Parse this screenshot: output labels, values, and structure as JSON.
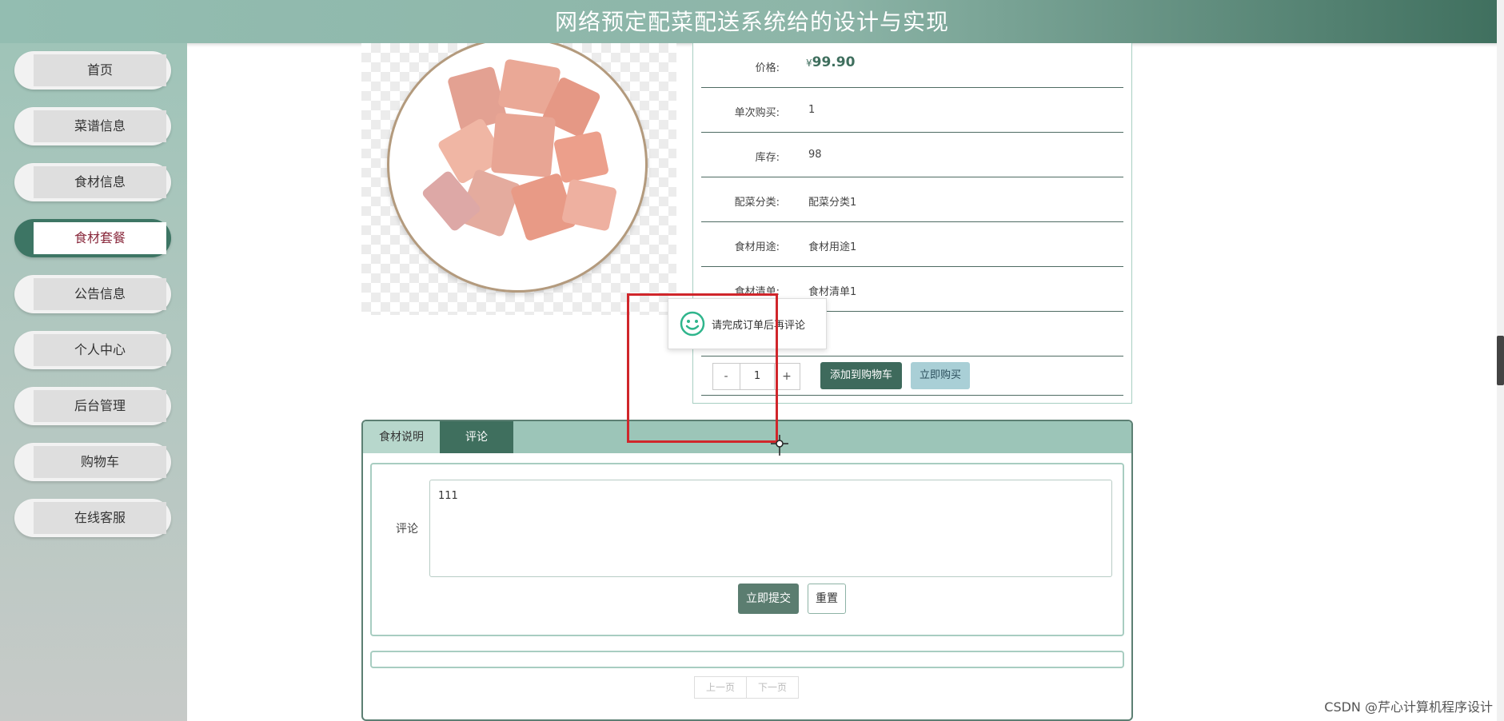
{
  "header": {
    "title": "网络预定配菜配送系统给的设计与实现"
  },
  "sidebar": {
    "items": [
      {
        "label": "首页"
      },
      {
        "label": "菜谱信息"
      },
      {
        "label": "食材信息"
      },
      {
        "label": "食材套餐"
      },
      {
        "label": "公告信息"
      },
      {
        "label": "个人中心"
      },
      {
        "label": "后台管理"
      },
      {
        "label": "购物车"
      },
      {
        "label": "在线客服"
      }
    ],
    "active": "食材套餐"
  },
  "product": {
    "price_label": "价格:",
    "price_symbol": "¥",
    "price_value": "99.90",
    "single_buy_label": "单次购买:",
    "single_buy_value": "1",
    "stock_label": "库存:",
    "stock_value": "98",
    "category_label": "配菜分类:",
    "category_value": "配菜分类1",
    "usage_label": "食材用途:",
    "usage_value": "食材用途1",
    "list_label": "食材清单:",
    "list_value": "食材清单1"
  },
  "quantity": {
    "minus": "-",
    "value": "1",
    "plus": "+"
  },
  "actions": {
    "add_to_cart": "添加到购物车",
    "buy_now": "立即购买"
  },
  "toast": {
    "message": "请完成订单后再评论",
    "icon": "smile-icon"
  },
  "tabs": [
    {
      "label": "食材说明"
    },
    {
      "label": "评论"
    }
  ],
  "active_tab": "评论",
  "comment_form": {
    "label": "评论",
    "value": "111",
    "submit": "立即提交",
    "reset": "重置"
  },
  "pager": {
    "prev": "上一页",
    "next": "下一页"
  },
  "watermark": "CSDN @芹心计算机程序设计",
  "colors": {
    "brand": "#3f6f5e",
    "accent_light": "#9cc5b8",
    "highlight_rect": "#d0262b"
  }
}
